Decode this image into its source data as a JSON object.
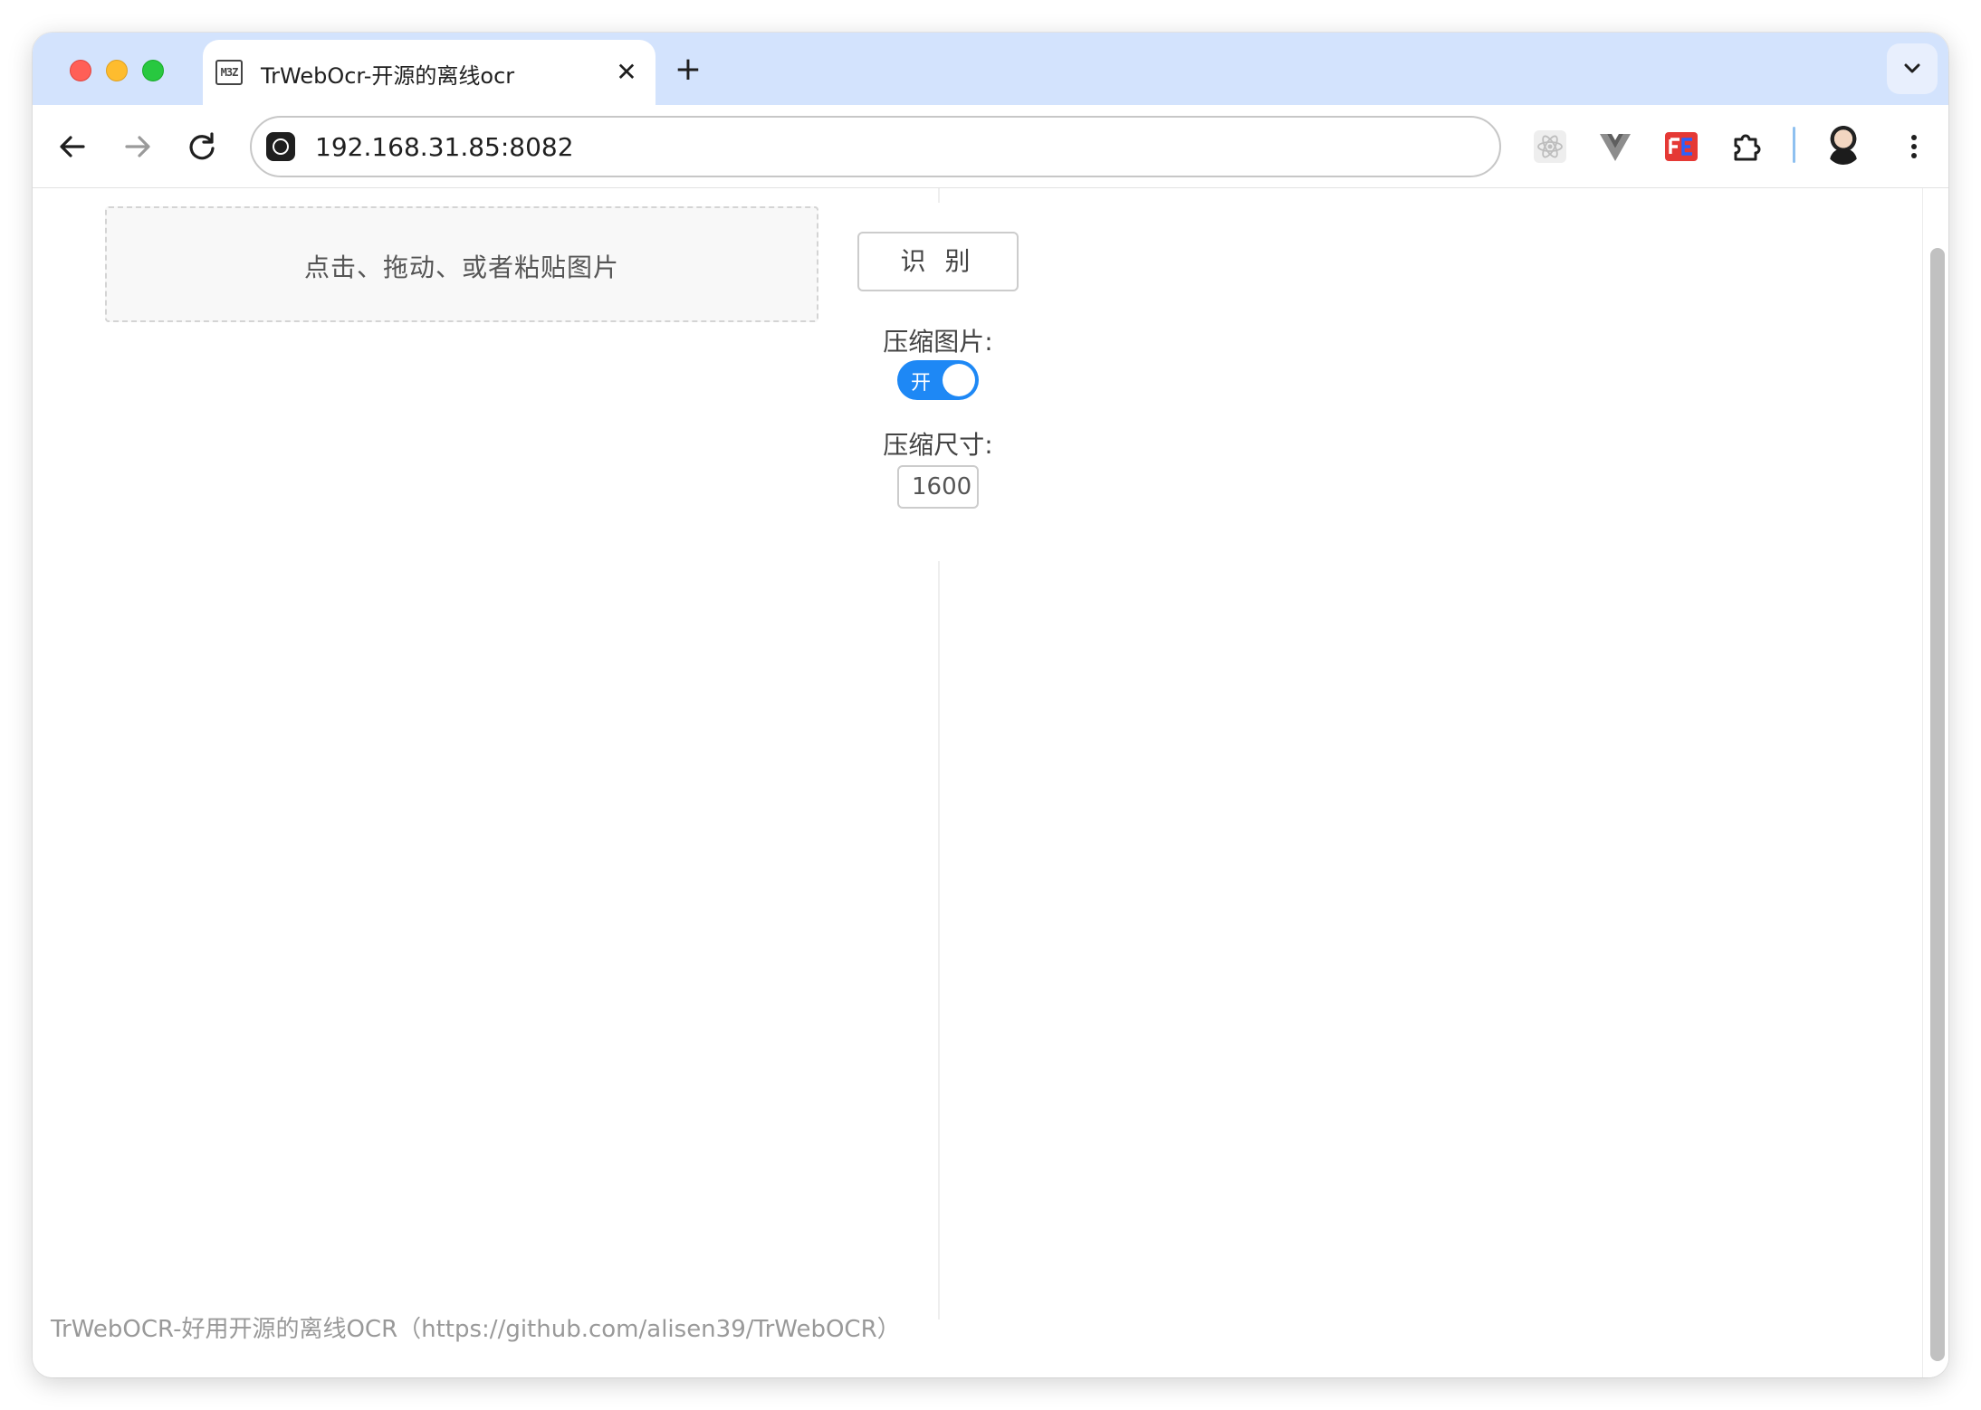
{
  "browser": {
    "tab": {
      "favicon_text": "M3Z",
      "title": "TrWebOcr-开源的离线ocr",
      "close_glyph": "✕"
    },
    "new_tab_glyph": "+",
    "url": "192.168.31.85:8082",
    "extensions": [
      "react-devtools-icon",
      "vue-devtools-icon",
      "fehelper-icon",
      "extensions-puzzle-icon"
    ],
    "accent_color": "#d3e3fd"
  },
  "page": {
    "upload": {
      "label": "点击、拖动、或者粘贴图片"
    },
    "recognize_button": "识 别",
    "compress": {
      "label": "压缩图片:",
      "toggle_text": "开",
      "toggle_on": true,
      "toggle_color": "#1e88f5"
    },
    "size": {
      "label": "压缩尺寸:",
      "value": "1600"
    },
    "footer": "TrWebOCR-好用开源的离线OCR（https://github.com/alisen39/TrWebOCR）"
  }
}
